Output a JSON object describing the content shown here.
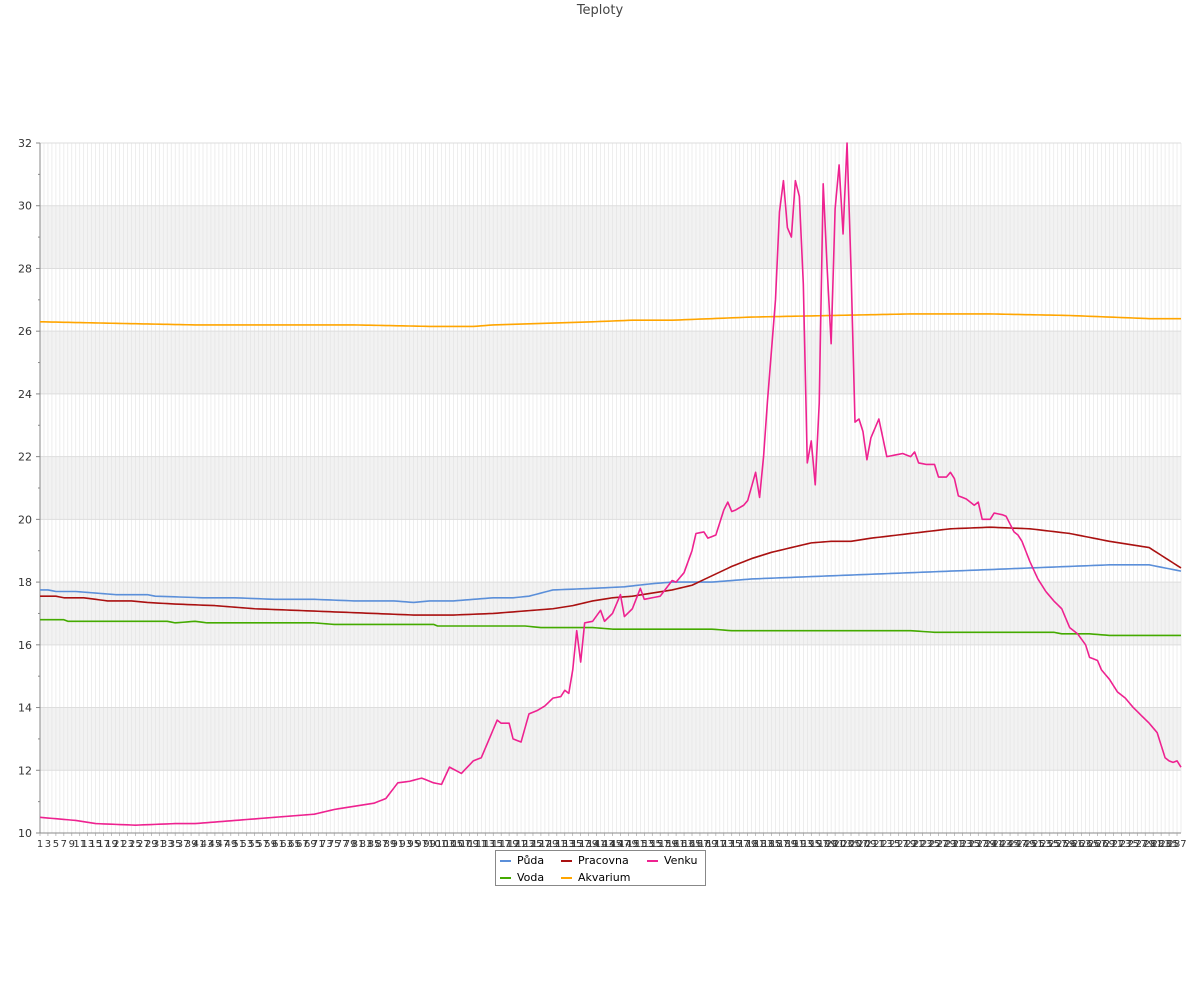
{
  "chart_data": {
    "type": "line",
    "title": "Teploty",
    "xlabel": "",
    "ylabel": "",
    "ylim": [
      10,
      32
    ],
    "yticks": [
      10,
      12,
      14,
      16,
      18,
      20,
      22,
      24,
      26,
      28,
      30,
      32
    ],
    "x_count": 288,
    "x_range": [
      1,
      288
    ],
    "grid": true,
    "legend_position": "bottom-center",
    "series": [
      {
        "name": "Půda",
        "color": "#5b8fd9",
        "knots": [
          [
            1,
            17.75
          ],
          [
            3,
            17.75
          ],
          [
            5,
            17.7
          ],
          [
            10,
            17.7
          ],
          [
            15,
            17.65
          ],
          [
            20,
            17.6
          ],
          [
            28,
            17.6
          ],
          [
            30,
            17.55
          ],
          [
            42,
            17.5
          ],
          [
            50,
            17.5
          ],
          [
            60,
            17.45
          ],
          [
            70,
            17.45
          ],
          [
            80,
            17.4
          ],
          [
            90,
            17.4
          ],
          [
            95,
            17.35
          ],
          [
            99,
            17.4
          ],
          [
            105,
            17.4
          ],
          [
            110,
            17.45
          ],
          [
            115,
            17.5
          ],
          [
            120,
            17.5
          ],
          [
            124,
            17.55
          ],
          [
            130,
            17.75
          ],
          [
            140,
            17.8
          ],
          [
            148,
            17.85
          ],
          [
            155,
            17.95
          ],
          [
            160,
            18.0
          ],
          [
            170,
            18.0
          ],
          [
            180,
            18.1
          ],
          [
            190,
            18.15
          ],
          [
            200,
            18.2
          ],
          [
            210,
            18.25
          ],
          [
            220,
            18.3
          ],
          [
            230,
            18.35
          ],
          [
            240,
            18.4
          ],
          [
            250,
            18.45
          ],
          [
            260,
            18.5
          ],
          [
            270,
            18.55
          ],
          [
            280,
            18.55
          ],
          [
            288,
            18.35
          ]
        ]
      },
      {
        "name": "Voda",
        "color": "#44aa00",
        "knots": [
          [
            1,
            16.8
          ],
          [
            7,
            16.8
          ],
          [
            8,
            16.75
          ],
          [
            30,
            16.75
          ],
          [
            33,
            16.75
          ],
          [
            35,
            16.7
          ],
          [
            40,
            16.75
          ],
          [
            43,
            16.7
          ],
          [
            70,
            16.7
          ],
          [
            75,
            16.65
          ],
          [
            90,
            16.65
          ],
          [
            100,
            16.65
          ],
          [
            101,
            16.6
          ],
          [
            115,
            16.6
          ],
          [
            123,
            16.6
          ],
          [
            127,
            16.55
          ],
          [
            130,
            16.55
          ],
          [
            137,
            16.55
          ],
          [
            140,
            16.55
          ],
          [
            145,
            16.5
          ],
          [
            160,
            16.5
          ],
          [
            170,
            16.5
          ],
          [
            175,
            16.45
          ],
          [
            187,
            16.45
          ],
          [
            190,
            16.45
          ],
          [
            210,
            16.45
          ],
          [
            220,
            16.45
          ],
          [
            226,
            16.4
          ],
          [
            240,
            16.4
          ],
          [
            256,
            16.4
          ],
          [
            258,
            16.35
          ],
          [
            265,
            16.35
          ],
          [
            270,
            16.3
          ],
          [
            288,
            16.3
          ]
        ]
      },
      {
        "name": "Pracovna",
        "color": "#aa1111",
        "knots": [
          [
            1,
            17.55
          ],
          [
            5,
            17.55
          ],
          [
            7,
            17.5
          ],
          [
            12,
            17.5
          ],
          [
            18,
            17.4
          ],
          [
            24,
            17.4
          ],
          [
            28,
            17.35
          ],
          [
            35,
            17.3
          ],
          [
            45,
            17.25
          ],
          [
            55,
            17.15
          ],
          [
            65,
            17.1
          ],
          [
            75,
            17.05
          ],
          [
            85,
            17.0
          ],
          [
            95,
            16.95
          ],
          [
            105,
            16.95
          ],
          [
            115,
            17.0
          ],
          [
            120,
            17.05
          ],
          [
            125,
            17.1
          ],
          [
            130,
            17.15
          ],
          [
            135,
            17.25
          ],
          [
            140,
            17.4
          ],
          [
            145,
            17.5
          ],
          [
            150,
            17.55
          ],
          [
            155,
            17.65
          ],
          [
            160,
            17.75
          ],
          [
            165,
            17.9
          ],
          [
            170,
            18.2
          ],
          [
            175,
            18.5
          ],
          [
            180,
            18.75
          ],
          [
            185,
            18.95
          ],
          [
            190,
            19.1
          ],
          [
            195,
            19.25
          ],
          [
            200,
            19.3
          ],
          [
            205,
            19.3
          ],
          [
            210,
            19.4
          ],
          [
            220,
            19.55
          ],
          [
            230,
            19.7
          ],
          [
            240,
            19.75
          ],
          [
            250,
            19.7
          ],
          [
            260,
            19.55
          ],
          [
            270,
            19.3
          ],
          [
            280,
            19.1
          ],
          [
            288,
            18.45
          ]
        ]
      },
      {
        "name": "Akvarium",
        "color": "#ffa500",
        "knots": [
          [
            1,
            26.3
          ],
          [
            20,
            26.25
          ],
          [
            40,
            26.2
          ],
          [
            60,
            26.2
          ],
          [
            80,
            26.2
          ],
          [
            100,
            26.15
          ],
          [
            110,
            26.15
          ],
          [
            115,
            26.2
          ],
          [
            140,
            26.3
          ],
          [
            150,
            26.35
          ],
          [
            160,
            26.35
          ],
          [
            180,
            26.45
          ],
          [
            200,
            26.5
          ],
          [
            220,
            26.55
          ],
          [
            240,
            26.55
          ],
          [
            260,
            26.5
          ],
          [
            270,
            26.45
          ],
          [
            280,
            26.4
          ],
          [
            288,
            26.4
          ]
        ]
      },
      {
        "name": "Venku",
        "color": "#ee2290",
        "knots": [
          [
            1,
            10.5
          ],
          [
            10,
            10.4
          ],
          [
            15,
            10.3
          ],
          [
            25,
            10.25
          ],
          [
            35,
            10.3
          ],
          [
            40,
            10.3
          ],
          [
            45,
            10.35
          ],
          [
            50,
            10.4
          ],
          [
            55,
            10.45
          ],
          [
            60,
            10.5
          ],
          [
            65,
            10.55
          ],
          [
            70,
            10.6
          ],
          [
            75,
            10.75
          ],
          [
            80,
            10.85
          ],
          [
            85,
            10.95
          ],
          [
            88,
            11.1
          ],
          [
            91,
            11.6
          ],
          [
            94,
            11.65
          ],
          [
            97,
            11.75
          ],
          [
            100,
            11.6
          ],
          [
            102,
            11.55
          ],
          [
            104,
            12.1
          ],
          [
            107,
            11.9
          ],
          [
            110,
            12.3
          ],
          [
            112,
            12.4
          ],
          [
            114,
            13.0
          ],
          [
            116,
            13.6
          ],
          [
            117,
            13.5
          ],
          [
            119,
            13.5
          ],
          [
            120,
            13.0
          ],
          [
            122,
            12.9
          ],
          [
            124,
            13.8
          ],
          [
            126,
            13.9
          ],
          [
            128,
            14.05
          ],
          [
            130,
            14.3
          ],
          [
            132,
            14.35
          ],
          [
            133,
            14.55
          ],
          [
            134,
            14.45
          ],
          [
            135,
            15.2
          ],
          [
            136,
            16.45
          ],
          [
            137,
            15.45
          ],
          [
            138,
            16.7
          ],
          [
            140,
            16.75
          ],
          [
            142,
            17.1
          ],
          [
            143,
            16.75
          ],
          [
            145,
            17.0
          ],
          [
            147,
            17.6
          ],
          [
            148,
            16.9
          ],
          [
            150,
            17.15
          ],
          [
            152,
            17.8
          ],
          [
            153,
            17.45
          ],
          [
            155,
            17.5
          ],
          [
            157,
            17.55
          ],
          [
            160,
            18.05
          ],
          [
            161,
            18.0
          ],
          [
            163,
            18.3
          ],
          [
            165,
            19.0
          ],
          [
            166,
            19.55
          ],
          [
            168,
            19.6
          ],
          [
            169,
            19.4
          ],
          [
            171,
            19.5
          ],
          [
            173,
            20.3
          ],
          [
            174,
            20.55
          ],
          [
            175,
            20.25
          ],
          [
            176,
            20.3
          ],
          [
            178,
            20.45
          ],
          [
            179,
            20.6
          ],
          [
            181,
            21.5
          ],
          [
            182,
            20.7
          ],
          [
            183,
            22.0
          ],
          [
            184,
            23.8
          ],
          [
            186,
            27.0
          ],
          [
            187,
            29.8
          ],
          [
            188,
            30.8
          ],
          [
            189,
            29.3
          ],
          [
            190,
            29.0
          ],
          [
            191,
            30.8
          ],
          [
            192,
            30.3
          ],
          [
            193,
            27.5
          ],
          [
            194,
            21.8
          ],
          [
            195,
            22.5
          ],
          [
            196,
            21.1
          ],
          [
            197,
            23.7
          ],
          [
            198,
            30.7
          ],
          [
            199,
            28.0
          ],
          [
            200,
            25.6
          ],
          [
            201,
            29.9
          ],
          [
            202,
            31.3
          ],
          [
            203,
            29.1
          ],
          [
            204,
            32.0
          ],
          [
            205,
            28.0
          ],
          [
            206,
            23.1
          ],
          [
            207,
            23.2
          ],
          [
            208,
            22.8
          ],
          [
            209,
            21.9
          ],
          [
            210,
            22.6
          ],
          [
            211,
            22.9
          ],
          [
            212,
            23.2
          ],
          [
            213,
            22.6
          ],
          [
            214,
            22.0
          ],
          [
            216,
            22.05
          ],
          [
            218,
            22.1
          ],
          [
            220,
            22.0
          ],
          [
            221,
            22.15
          ],
          [
            222,
            21.8
          ],
          [
            224,
            21.75
          ],
          [
            226,
            21.75
          ],
          [
            227,
            21.35
          ],
          [
            229,
            21.35
          ],
          [
            230,
            21.5
          ],
          [
            231,
            21.3
          ],
          [
            232,
            20.75
          ],
          [
            234,
            20.65
          ],
          [
            236,
            20.45
          ],
          [
            237,
            20.55
          ],
          [
            238,
            20.0
          ],
          [
            240,
            20.0
          ],
          [
            241,
            20.2
          ],
          [
            243,
            20.15
          ],
          [
            244,
            20.1
          ],
          [
            246,
            19.6
          ],
          [
            247,
            19.5
          ],
          [
            248,
            19.3
          ],
          [
            250,
            18.65
          ],
          [
            252,
            18.1
          ],
          [
            254,
            17.7
          ],
          [
            256,
            17.4
          ],
          [
            258,
            17.15
          ],
          [
            260,
            16.55
          ],
          [
            262,
            16.35
          ],
          [
            264,
            16.0
          ],
          [
            265,
            15.6
          ],
          [
            267,
            15.5
          ],
          [
            268,
            15.2
          ],
          [
            270,
            14.9
          ],
          [
            272,
            14.5
          ],
          [
            274,
            14.3
          ],
          [
            276,
            14.0
          ],
          [
            278,
            13.75
          ],
          [
            280,
            13.5
          ],
          [
            282,
            13.2
          ],
          [
            284,
            12.4
          ],
          [
            285,
            12.3
          ],
          [
            286,
            12.25
          ],
          [
            287,
            12.3
          ],
          [
            288,
            12.1
          ]
        ]
      }
    ]
  }
}
